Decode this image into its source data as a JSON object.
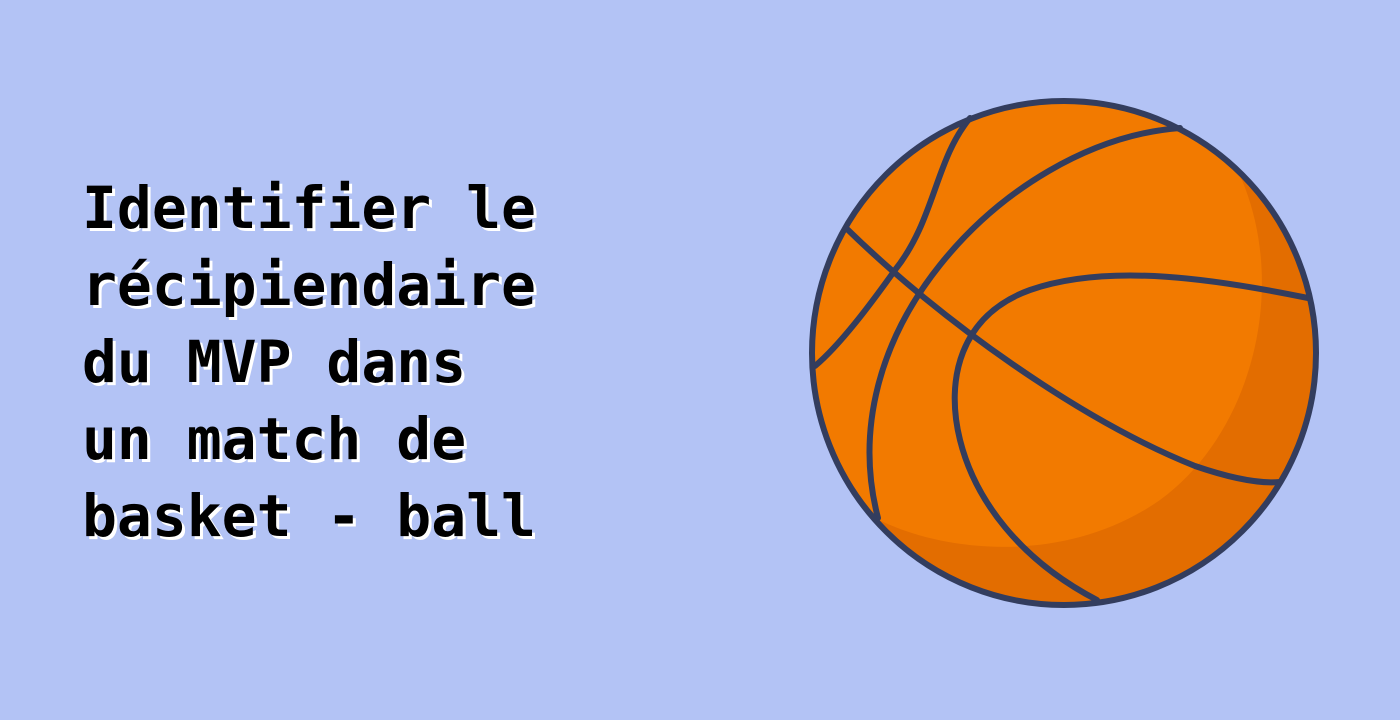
{
  "background_color": "#b3c3f5",
  "title": {
    "lines": [
      "Identifier le",
      "récipiendaire",
      "du MVP dans",
      "un match de",
      "basket - ball"
    ],
    "color": "#000000",
    "shadow_color": "#ffffff"
  },
  "illustration": {
    "icon": "basketball-icon",
    "fill_color": "#f27a00",
    "shade_color": "#e36d00",
    "stroke_color": "#333d5e"
  }
}
